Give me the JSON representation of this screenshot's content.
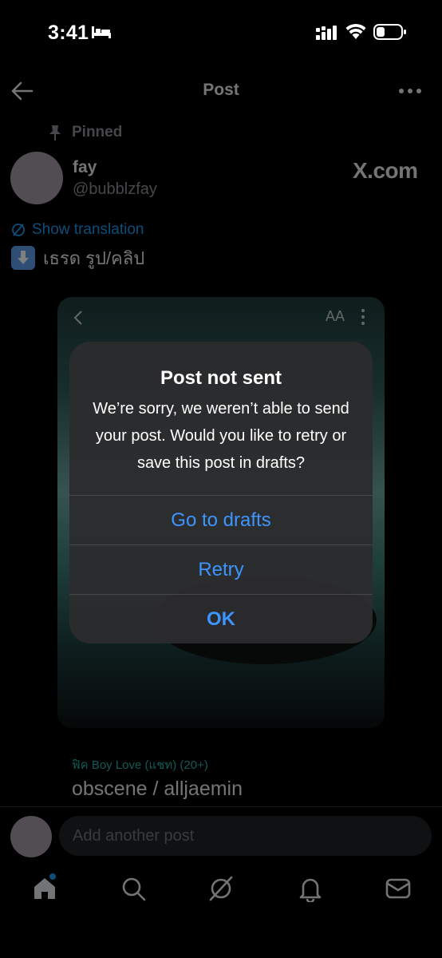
{
  "status_bar": {
    "time": "3:41",
    "icons": [
      "bed-icon",
      "signal-icon",
      "wifi-icon",
      "battery-icon"
    ]
  },
  "nav": {
    "title": "Post",
    "back_icon": "back-arrow-icon",
    "more_icon": "more-horizontal-icon"
  },
  "post": {
    "pinned_label": "Pinned",
    "display_name": "fay",
    "handle": "@bubblzfay",
    "source": "X.com",
    "translate_label": "Show translation",
    "text": "เธรด รูป/คลิป",
    "media": {
      "aa_label": "AA"
    },
    "tag_line": "ฟิค Boy Love (แชท) (20+)",
    "title_line": "obscene / alljaemin"
  },
  "reply": {
    "placeholder": "Add another post"
  },
  "tab_bar": {
    "items": [
      "home-icon",
      "search-icon",
      "grok-icon",
      "notifications-icon",
      "messages-icon"
    ]
  },
  "alert": {
    "title": "Post not sent",
    "message": "We’re sorry, we weren’t able to send your post. Would you like to retry or save this post in drafts?",
    "buttons": {
      "drafts": "Go to drafts",
      "retry": "Retry",
      "ok": "OK"
    }
  },
  "colors": {
    "accent": "#1d9bf0",
    "alert_button": "#3d95ff",
    "alert_bg": "#2c2c2e"
  }
}
